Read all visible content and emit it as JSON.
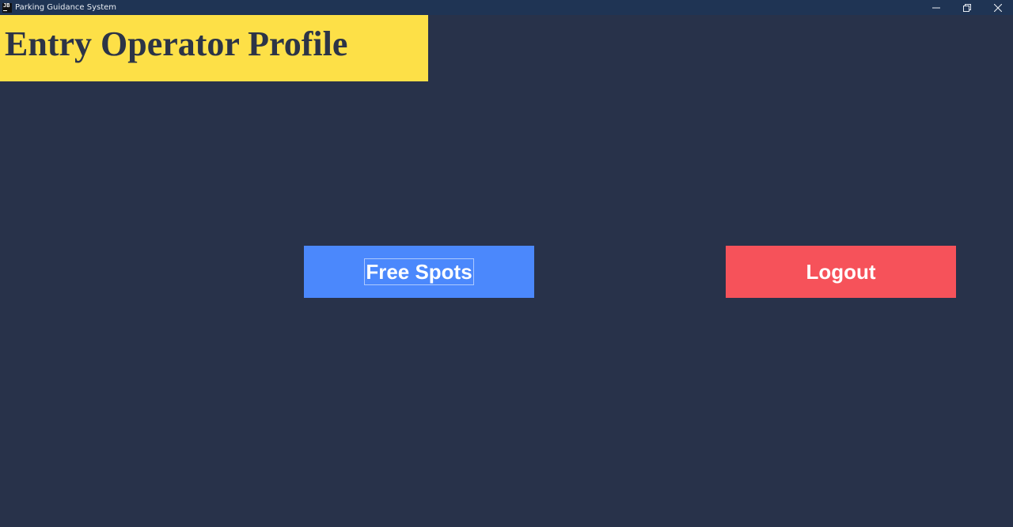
{
  "window": {
    "icon_text": "JB",
    "title": "Parking Guidance System",
    "controls": [
      "minimize-icon",
      "restore-icon",
      "close-icon"
    ]
  },
  "header": {
    "title": "Entry Operator Profile",
    "background": "#fde047"
  },
  "actions": {
    "free_spots_label": "Free Spots",
    "free_spots_color": "#4b88fc",
    "logout_label": "Logout",
    "logout_color": "#f6525a"
  },
  "theme": {
    "background": "#28324a",
    "titlebar": "#1f3454"
  }
}
